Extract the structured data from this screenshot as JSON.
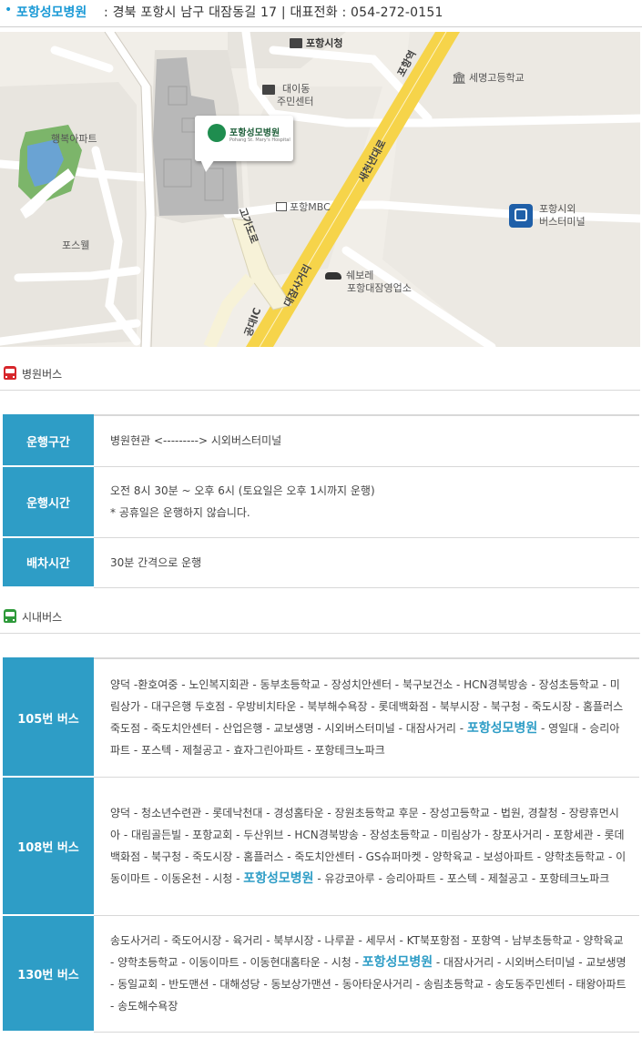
{
  "header": {
    "hospital_name": "포항성모병원",
    "address": ": 경북 포항시 남구 대잠동길 17  |  대표전화 : 054-272-0151"
  },
  "map": {
    "labels": {
      "city_hall": "포항시청",
      "daeidong_1": "대이동",
      "daeidong_2": "주민센터",
      "semyeong": "세명고등학교",
      "haengbok": "행복아파트",
      "mbc": "포항MBC",
      "terminal_1": "포항시외",
      "terminal_2": "버스터미널",
      "posuwel": "포스웰",
      "chevrolet_1": "쉐보레",
      "chevrolet_2": "포항대잠영업소",
      "road_pohangyeok": "포항역",
      "road_saecheonnyeon": "새천년대로",
      "road_godaero": "고가도로",
      "road_daejam": "대잠사거리",
      "road_ic": "공대IC",
      "marker_name": "포항성모병원",
      "marker_sub": "Pohang St. Mary's Hospital"
    },
    "colors": {
      "road_yellow": "#f6d44a",
      "block": "#e6e3dd",
      "building": "#b7b7b7",
      "park": "#79b56b"
    }
  },
  "hospital_bus": {
    "title": "병원버스",
    "icon": "bus-icon",
    "color": "#d7262b",
    "rows": [
      {
        "label": "운행구간",
        "lines": [
          "병원현관 <---------> 시외버스터미널"
        ]
      },
      {
        "label": "운행시간",
        "lines": [
          "오전 8시 30분 ~ 오후 6시 (토요일은 오후 1시까지 운행)",
          "* 공휴일은 운행하지 않습니다."
        ]
      },
      {
        "label": "배차시간",
        "lines": [
          "30분 간격으로 운행"
        ]
      }
    ]
  },
  "city_bus": {
    "title": "시내버스",
    "icon": "bus-icon",
    "color": "#2f9a3b",
    "highlight": "포항성모병원",
    "rows": [
      {
        "label": "105번 버스",
        "before": "양덕 -환호여중 - 노인복지회관 - 동부초등학교 - 장성치안센터 - 북구보건소 - HCN경북방송 - 장성초등학교 - 미림상가 - 대구은행 두호점 - 우방비치타운 - 북부해수욕장 - 롯데백화점 - 북부시장 - 북구청 - 죽도시장 - 홈플러스 죽도점 - 죽도치안센터 - 산업은행 - 교보생명 - 시외버스터미널 - 대잠사거리 - ",
        "after": " - 영일대 - 승리아파트 - 포스텍 - 제철공고 - 효자그린아파트 - 포항테크노파크"
      },
      {
        "label": "108번 버스",
        "before": "양덕 - 청소년수련관 - 롯데낙천대 - 경성홈타운 - 장원초등학교 후문 - 장성고등학교 - 법원, 경찰청 - 장량휴먼시아 - 대림골든빌 - 포항교회 - 두산위브 - HCN경북방송 - 장성초등학교 - 미림상가 - 창포사거리 - 포항세관 - 롯데백화점 - 북구청 - 죽도시장 - 홈플러스 - 죽도치안센터 - GS슈퍼마켓 - 양학육교 - 보성아파트 - 양학초등학교 - 이동이마트 - 이동온천 - 시청 - ",
        "after": " - 유강코아루 - 승리아파트 - 포스텍 - 제철공고 - 포항테크노파크"
      },
      {
        "label": "130번 버스",
        "before": "송도사거리 - 죽도어시장 - 육거리 - 북부시장 - 나루끝 - 세무서 - KT북포항점 - 포항역 - 남부초등학교 - 양학육교 - 양학초등학교 - 이동이마트 - 이동현대홈타운 - 시청 - ",
        "after": " - 대잠사거리 - 시외버스터미널 - 교보생명 - 동일교회 - 반도맨션 - 대해성당 - 동보상가맨션 - 동아타운사거리 - 송림초등학교 - 송도동주민센터 - 태왕아파트 - 송도해수욕장"
      }
    ]
  }
}
